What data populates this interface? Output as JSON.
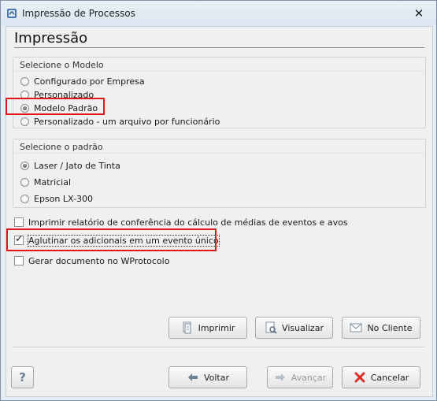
{
  "window": {
    "title": "Impressão de Processos",
    "close_glyph": "✕"
  },
  "heading": "Impressão",
  "model_group": {
    "title": "Selecione o Modelo",
    "options": [
      {
        "label": "Configurado por Empresa",
        "selected": false
      },
      {
        "label": "Personalizado",
        "selected": false
      },
      {
        "label": "Modelo Padrão",
        "selected": true
      },
      {
        "label": "Personalizado - um arquivo por funcionário",
        "selected": false
      }
    ]
  },
  "pattern_group": {
    "title": "Selecione o padrão",
    "options": [
      {
        "label": "Laser / Jato de Tinta",
        "selected": true
      },
      {
        "label": "Matricial",
        "selected": false
      },
      {
        "label": "Epson LX-300",
        "selected": false
      }
    ]
  },
  "checkboxes": [
    {
      "label": "Imprimir relatório de conferência do cálculo de médias de eventos e avos",
      "checked": false
    },
    {
      "label": "Aglutinar os adicionais em um evento único",
      "checked": true
    },
    {
      "label": "Gerar documento no WProtocolo",
      "checked": false
    }
  ],
  "actions": {
    "print_label": "Imprimir",
    "view_label": "Visualizar",
    "client_label": "No Cliente"
  },
  "footer": {
    "help_label": "?",
    "back_label": "Voltar",
    "next_label": "Avançar",
    "cancel_label": "Cancelar"
  },
  "colors": {
    "highlight_box": "#e0141b",
    "cancel_icon": "#d9302a",
    "arrow_icon": "#6d8299"
  },
  "icons": [
    "app-icon",
    "close-icon",
    "print-icon",
    "view-icon",
    "envelope-icon",
    "help-icon",
    "arrow-left-icon",
    "arrow-right-icon",
    "cancel-x-icon"
  ]
}
